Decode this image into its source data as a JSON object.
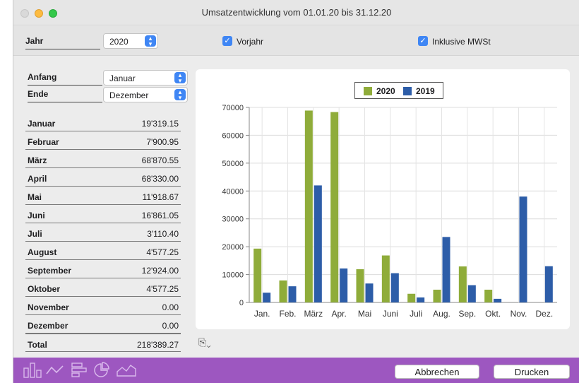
{
  "window": {
    "title": "Umsatzentwicklung vom 01.01.20 bis 31.12.20"
  },
  "header": {
    "jahr_label": "Jahr",
    "jahr_value": "2020",
    "vorjahr_label": "Vorjahr",
    "mwst_label": "Inklusive MWSt"
  },
  "range": {
    "anfang_label": "Anfang",
    "anfang_value": "Januar",
    "ende_label": "Ende",
    "ende_value": "Dezember"
  },
  "months": [
    {
      "name": "Januar",
      "value": "19'319.15"
    },
    {
      "name": "Februar",
      "value": "7'900.95"
    },
    {
      "name": "März",
      "value": "68'870.55"
    },
    {
      "name": "April",
      "value": "68'330.00"
    },
    {
      "name": "Mai",
      "value": "11'918.67"
    },
    {
      "name": "Juni",
      "value": "16'861.05"
    },
    {
      "name": "Juli",
      "value": "3'110.40"
    },
    {
      "name": "August",
      "value": "4'577.25"
    },
    {
      "name": "September",
      "value": "12'924.00"
    },
    {
      "name": "Oktober",
      "value": "4'577.25"
    },
    {
      "name": "November",
      "value": "0.00"
    },
    {
      "name": "Dezember",
      "value": "0.00"
    }
  ],
  "total": {
    "name": "Total",
    "value": "218'389.27"
  },
  "buttons": {
    "cancel": "Abbrechen",
    "print": "Drucken"
  },
  "colors": {
    "series_2020": "#8fac3a",
    "series_2019": "#2d5da8",
    "bottom_bar": "#9d57c0",
    "accent": "#3f86f4"
  },
  "icons": [
    "bar-chart-icon",
    "line-chart-icon",
    "horizontal-bar-icon",
    "pie-chart-icon",
    "area-chart-icon",
    "export-icon"
  ],
  "chart_data": {
    "type": "bar",
    "categories": [
      "Jan.",
      "Feb.",
      "März",
      "Apr.",
      "Mai",
      "Juni",
      "Juli",
      "Aug.",
      "Sep.",
      "Okt.",
      "Nov.",
      "Dez."
    ],
    "series": [
      {
        "name": "2020",
        "values": [
          19319,
          7901,
          68871,
          68330,
          11919,
          16861,
          3110,
          4577,
          12924,
          4577,
          0,
          0
        ]
      },
      {
        "name": "2019",
        "values": [
          3500,
          5800,
          42000,
          12200,
          6800,
          10500,
          1800,
          23500,
          6200,
          1300,
          38000,
          13000
        ]
      }
    ],
    "ylim": [
      0,
      70000
    ],
    "yticks": [
      "0",
      "10000",
      "20000",
      "30000",
      "40000",
      "50000",
      "60000",
      "70000"
    ],
    "legend": "top-center",
    "grid": true
  }
}
